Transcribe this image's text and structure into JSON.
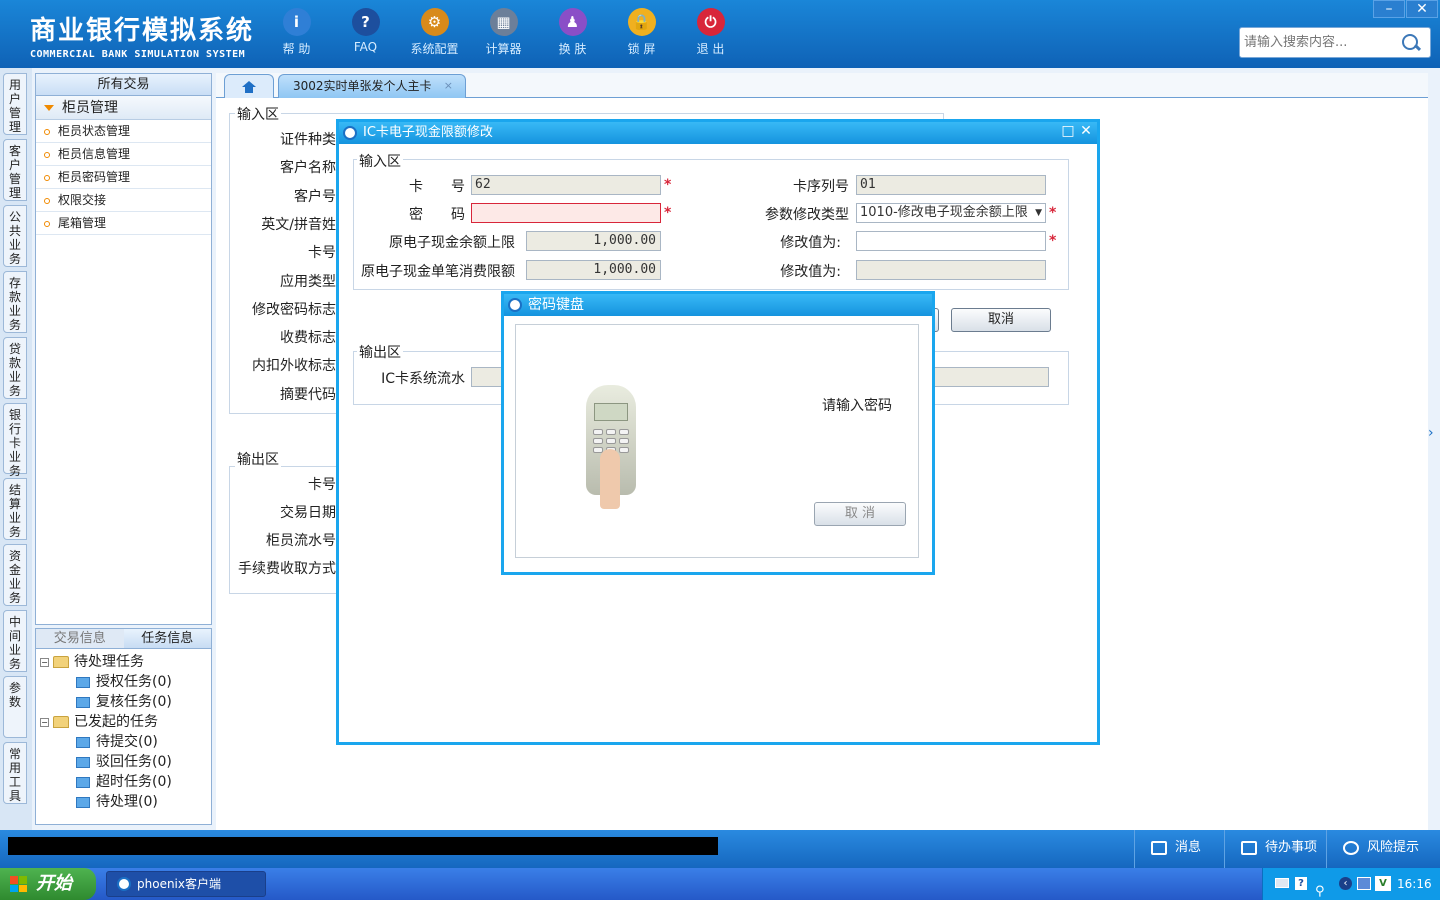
{
  "app": {
    "title_cn": "商业银行模拟系统",
    "title_en": "COMMERCIAL BANK SIMULATION SYSTEM",
    "search_placeholder": "请输入搜索内容...",
    "win_min": "–",
    "win_close": "✕"
  },
  "toolbar": [
    {
      "label": "帮 助",
      "glyph": "i",
      "color": "#2f7fd6",
      "icon": "info-icon"
    },
    {
      "label": "FAQ",
      "glyph": "?",
      "color": "#1d4f9e",
      "icon": "question-icon"
    },
    {
      "label": "系统配置",
      "glyph": "⚙",
      "color": "#d88a1a",
      "icon": "toolbox-icon"
    },
    {
      "label": "计算器",
      "glyph": "▦",
      "color": "#6c7f99",
      "icon": "calculator-icon"
    },
    {
      "label": "换 肤",
      "glyph": "♟",
      "color": "#8a4fc7",
      "icon": "skin-icon"
    },
    {
      "label": "锁 屏",
      "glyph": "🔒",
      "color": "#f0b020",
      "icon": "lock-icon"
    },
    {
      "label": "退 出",
      "glyph": "⏻",
      "color": "#d8263a",
      "icon": "power-icon"
    }
  ],
  "vnav": [
    "用户管理",
    "客户管理",
    "公共业务",
    "存款业务",
    "贷款业务",
    "银行卡业务",
    "结算业务",
    "资金业务",
    "中间业务",
    "参数",
    "常用工具"
  ],
  "left_panel": {
    "header": "所有交易",
    "group": "柜员管理",
    "items": [
      "柜员状态管理",
      "柜员信息管理",
      "柜员密码管理",
      "权限交接",
      "尾箱管理"
    ]
  },
  "task_panel": {
    "tabs": [
      "交易信息",
      "任务信息"
    ],
    "pending_group": "待处理任务",
    "pending": [
      "授权任务(0)",
      "复核任务(0)"
    ],
    "initiated_group": "已发起的任务",
    "initiated": [
      "待提交(0)",
      "驳回任务(0)",
      "超时任务(0)",
      "待处理(0)"
    ]
  },
  "tabs": {
    "active": "3002实时单张发个人主卡",
    "close": "×"
  },
  "bg_form": {
    "input_section": "输入区",
    "labels": [
      "证件种类",
      "客户名称",
      "客户号",
      "英文/拼音姓",
      "卡号",
      "应用类型",
      "修改密码标志",
      "收费标志",
      "内扣外收标志",
      "摘要代码"
    ],
    "output_section": "输出区",
    "output_labels": [
      "卡号",
      "交易日期",
      "柜员流水号",
      "手续费收取方式"
    ]
  },
  "modal": {
    "title": "IC卡电子现金限额修改",
    "input_section": "输入区",
    "card_no_label": "卡　　号",
    "card_no_value": "62",
    "password_label": "密　　码",
    "orig_balance_limit_label": "原电子现金余额上限",
    "orig_balance_limit_value": "1,000.00",
    "orig_single_limit_label": "原电子现金单笔消费限额",
    "orig_single_limit_value": "1,000.00",
    "card_seq_label": "卡序列号",
    "card_seq_value": "01",
    "param_type_label": "参数修改类型",
    "param_type_value": "1010-修改电子现金余额上限",
    "modify_value_label_1": "修改值为:",
    "modify_value_label_2": "修改值为:",
    "cancel_btn": "取消",
    "output_section": "输出区",
    "ic_serial_label": "IC卡系统流水",
    "required": "*"
  },
  "pin_dialog": {
    "title": "密码键盘",
    "prompt": "请输入密码",
    "cancel_btn": "取 消"
  },
  "statusbar": {
    "messages": "消息",
    "todo": "待办事项",
    "risk": "风险提示"
  },
  "taskbar": {
    "start": "开始",
    "window": "phoenix客户端",
    "clock": "16:16"
  }
}
